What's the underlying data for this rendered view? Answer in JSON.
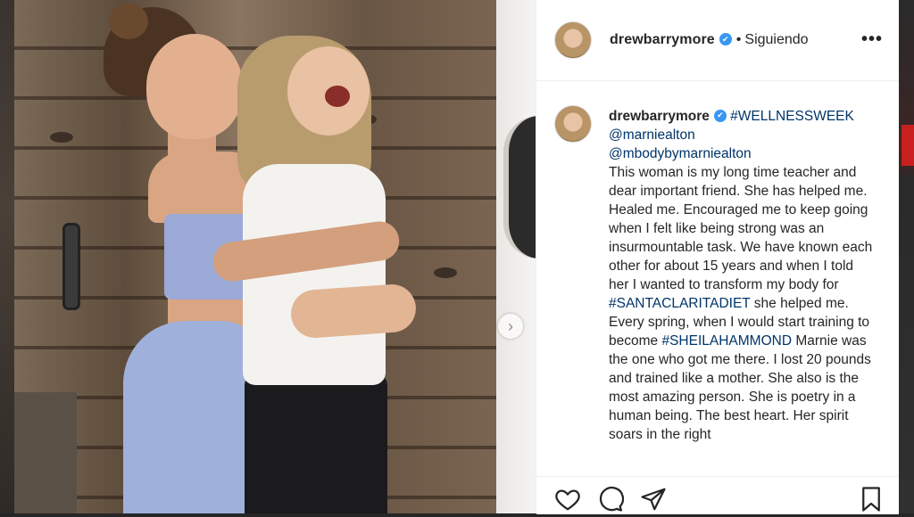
{
  "post": {
    "username": "drewbarrymore",
    "separator": "•",
    "follow_status": "Siguiendo",
    "more_icon": "•••",
    "carousel_next_glyph": "›",
    "caption": {
      "username": "drewbarrymore",
      "hashtag_1": "#WELLNESSWEEK",
      "mention_1": "@marniealton",
      "mention_2": "@mbodybymarniealton",
      "text_1": "This woman is my long time teacher and dear important friend. She has helped me. Healed me. Encouraged me to keep going when I felt like being strong was an insurmountable task. We have known each other for about 15 years and when I told her I wanted to transform my body for",
      "hashtag_2": "#SANTACLARITADIET",
      "text_2": "she helped me. Every spring, when I would start training to become",
      "hashtag_3": "#SHEILAHAMMOND",
      "text_3": "Marnie was the one who got me there. I lost 20 pounds and trained like a mother. She also is the most amazing person. She is poetry in a human being. The best heart. Her spirit soars in the right"
    },
    "actions": {
      "like_icon": "heart-icon",
      "comment_icon": "comment-icon",
      "share_icon": "paper-plane-icon",
      "save_icon": "bookmark-icon"
    },
    "colors": {
      "link": "#003569",
      "verified": "#3897f0",
      "text": "#262626"
    }
  }
}
